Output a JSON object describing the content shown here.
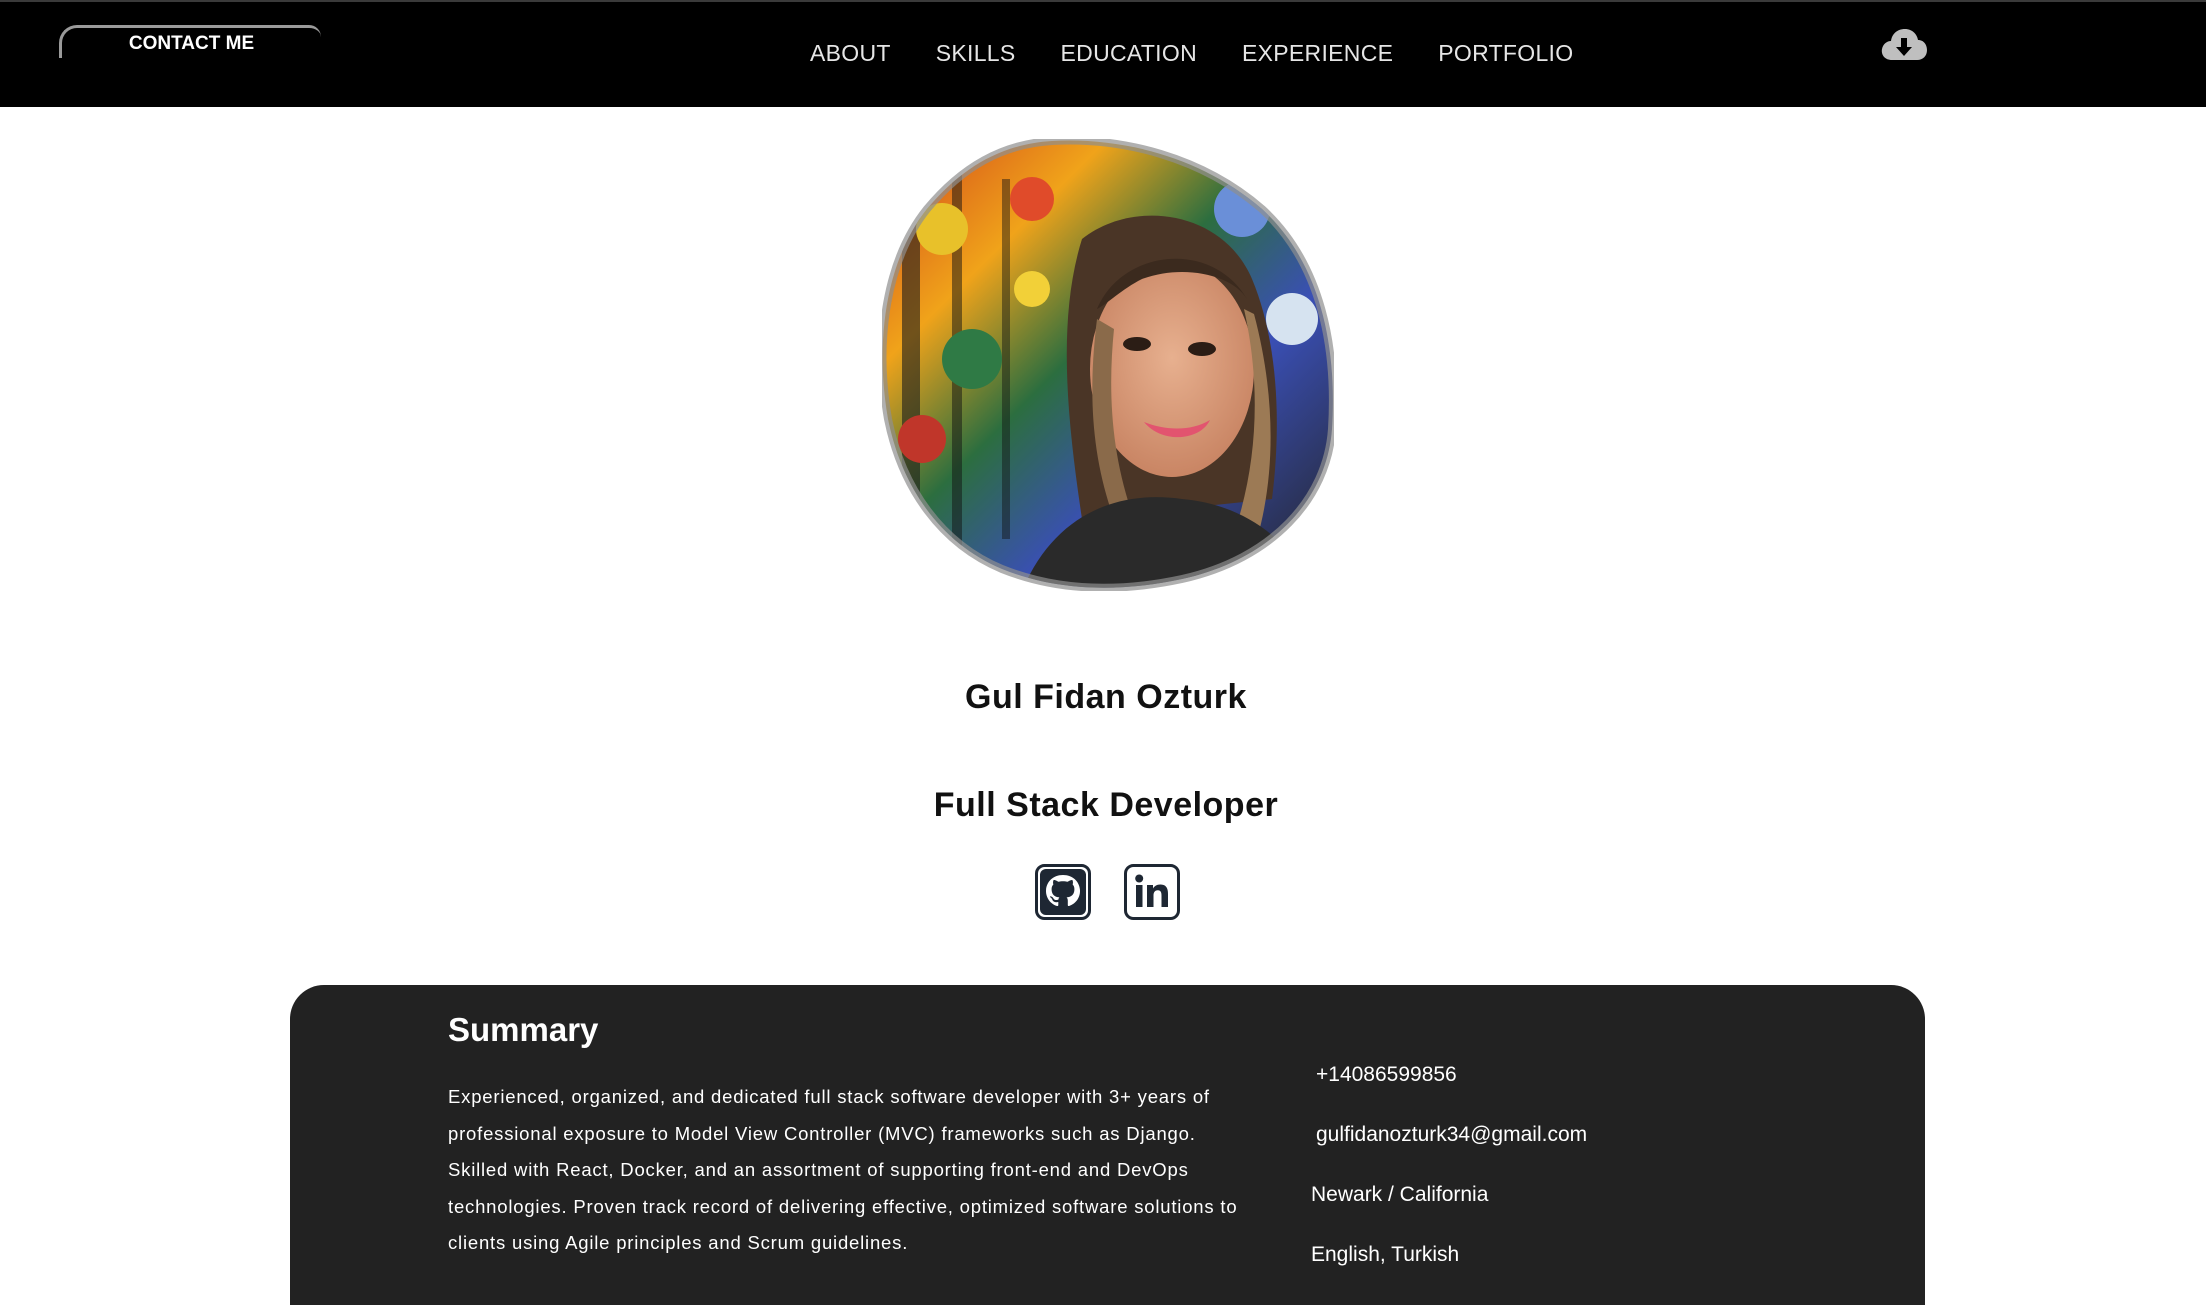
{
  "navbar": {
    "contact_label": "CONTACT ME",
    "links": [
      "ABOUT",
      "SKILLS",
      "EDUCATION",
      "EXPERIENCE",
      "PORTFOLIO"
    ],
    "download_icon": "cloud-download-icon"
  },
  "profile": {
    "name": "Gul Fidan Ozturk",
    "title": "Full Stack Developer",
    "social_icons": [
      "github-icon",
      "linkedin-icon"
    ]
  },
  "summary": {
    "heading": "Summary",
    "text": "Experienced, organized, and dedicated full stack software developer with 3+ years of professional exposure to Model View Controller (MVC) frameworks such as Django. Skilled with React, Docker, and an assortment of supporting front-end and DevOps technologies. Proven track record of delivering effective, optimized software solutions to clients using Agile principles and Scrum guidelines."
  },
  "contact": {
    "phone": "+14086599856",
    "email": "gulfidanozturk34@gmail.com",
    "location": "Newark / California",
    "languages": "English, Turkish"
  },
  "colors": {
    "navbar_bg": "#000000",
    "panel_bg": "#222222",
    "text_dark": "#111111"
  }
}
